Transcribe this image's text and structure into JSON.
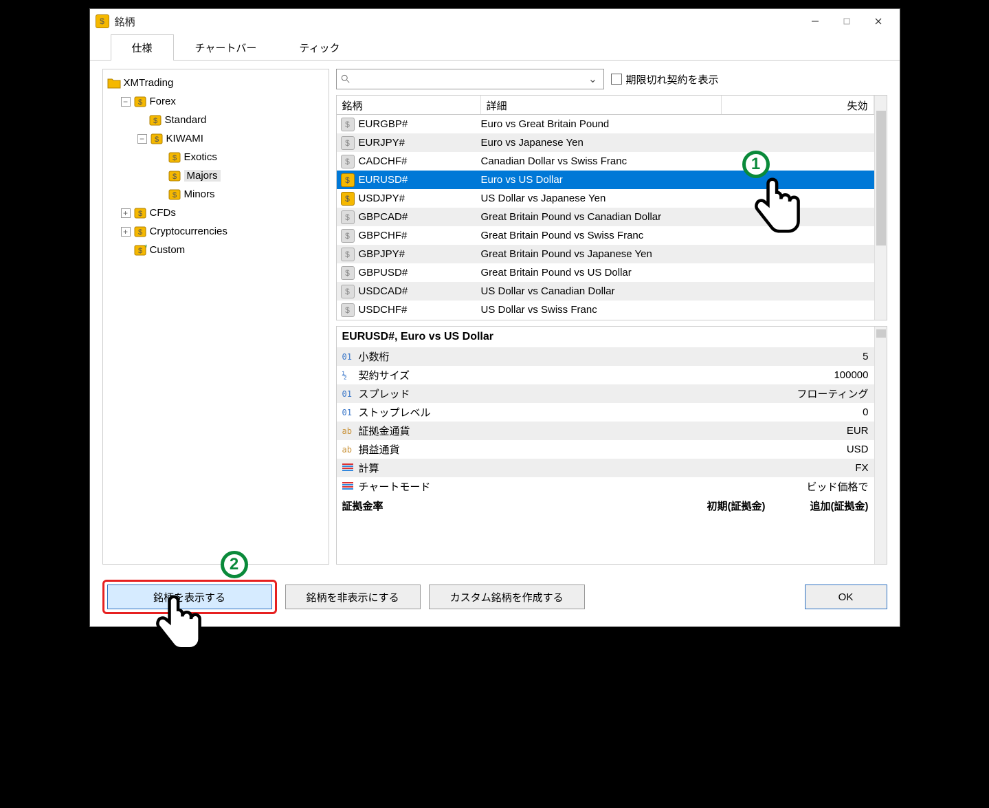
{
  "window": {
    "title": "銘柄"
  },
  "tabs": [
    {
      "label": "仕様",
      "active": true
    },
    {
      "label": "チャートバー",
      "active": false
    },
    {
      "label": "ティック",
      "active": false
    }
  ],
  "tree": {
    "root": "XMTrading",
    "forex": "Forex",
    "standard": "Standard",
    "kiwami": "KIWAMI",
    "exotics": "Exotics",
    "majors": "Majors",
    "minors": "Minors",
    "cfds": "CFDs",
    "crypto": "Cryptocurrencies",
    "custom": "Custom"
  },
  "search": {
    "placeholder": ""
  },
  "expired_checkbox_label": "期限切れ契約を表示",
  "grid": {
    "headers": {
      "symbol": "銘柄",
      "detail": "詳細",
      "expiry": "失効"
    },
    "rows": [
      {
        "sym": "EURGBP#",
        "det": "Euro vs Great Britain Pound",
        "gold": false,
        "sel": false
      },
      {
        "sym": "EURJPY#",
        "det": "Euro vs Japanese Yen",
        "gold": false,
        "sel": false
      },
      {
        "sym": "CADCHF#",
        "det": "Canadian Dollar vs Swiss Franc",
        "gold": false,
        "sel": false
      },
      {
        "sym": "EURUSD#",
        "det": "Euro vs US Dollar",
        "gold": true,
        "sel": true
      },
      {
        "sym": "USDJPY#",
        "det": "US Dollar vs Japanese Yen",
        "gold": true,
        "sel": false
      },
      {
        "sym": "GBPCAD#",
        "det": "Great Britain Pound vs Canadian Dollar",
        "gold": false,
        "sel": false
      },
      {
        "sym": "GBPCHF#",
        "det": "Great Britain Pound vs Swiss Franc",
        "gold": false,
        "sel": false
      },
      {
        "sym": "GBPJPY#",
        "det": "Great Britain Pound vs Japanese Yen",
        "gold": false,
        "sel": false
      },
      {
        "sym": "GBPUSD#",
        "det": "Great Britain Pound vs US Dollar",
        "gold": false,
        "sel": false
      },
      {
        "sym": "USDCAD#",
        "det": "US Dollar vs Canadian Dollar",
        "gold": false,
        "sel": false
      },
      {
        "sym": "USDCHF#",
        "det": "US Dollar vs Swiss Franc",
        "gold": false,
        "sel": false
      }
    ]
  },
  "detail": {
    "title": "EURUSD#, Euro vs US Dollar",
    "rows": [
      {
        "proto": "01",
        "pc": "",
        "label": "小数桁",
        "val": "5"
      },
      {
        "proto": "½",
        "pc": "",
        "label": "契約サイズ",
        "val": "100000"
      },
      {
        "proto": "01",
        "pc": "",
        "label": "スプレッド",
        "val": "フローティング"
      },
      {
        "proto": "01",
        "pc": "",
        "label": "ストップレベル",
        "val": "0"
      },
      {
        "proto": "ab",
        "pc": "ab",
        "label": "証拠金通貨",
        "val": "EUR"
      },
      {
        "proto": "ab",
        "pc": "ab",
        "label": "損益通貨",
        "val": "USD"
      },
      {
        "proto": "≡",
        "pc": "ic",
        "label": "計算",
        "val": "FX"
      },
      {
        "proto": "≡",
        "pc": "ic",
        "label": "チャートモード",
        "val": "ビッド価格で"
      }
    ],
    "footer": {
      "label": "証拠金率",
      "col2": "初期(証拠金)",
      "col3": "追加(証拠金)"
    }
  },
  "buttons": {
    "show": "銘柄を表示する",
    "hide": "銘柄を非表示にする",
    "create": "カスタム銘柄を作成する",
    "ok": "OK"
  },
  "callouts": {
    "one": "1",
    "two": "2"
  }
}
